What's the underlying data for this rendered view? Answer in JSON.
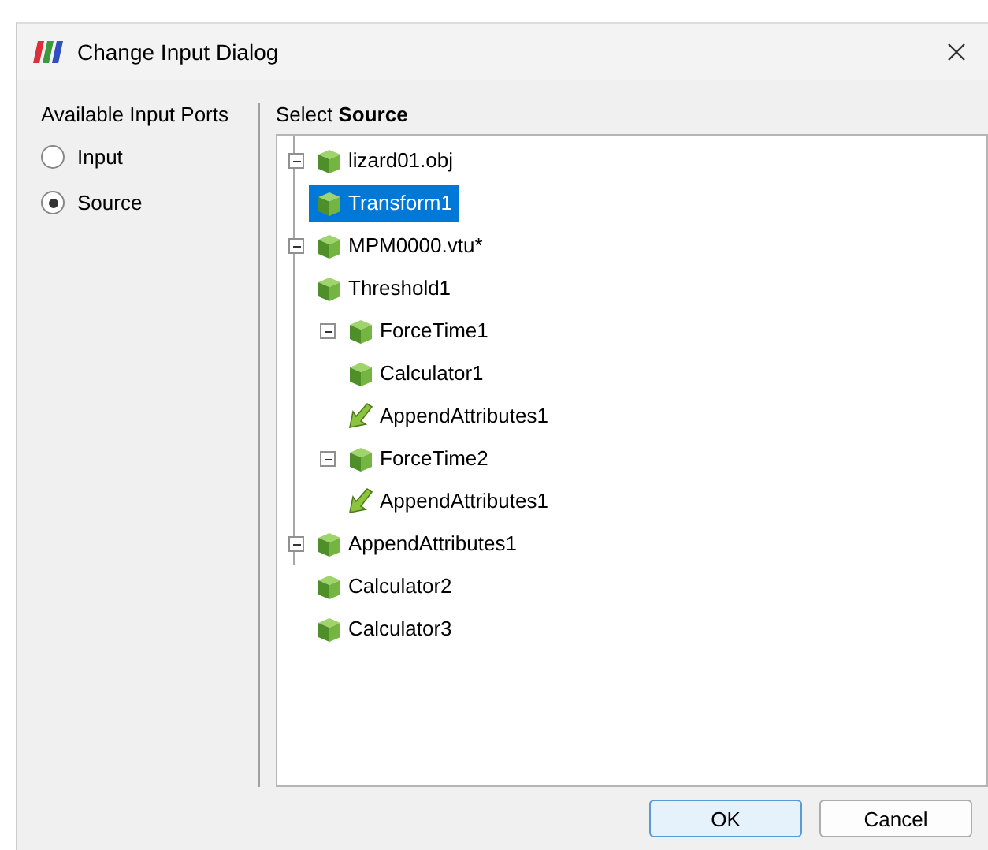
{
  "window": {
    "title": "Change Input Dialog"
  },
  "ports": {
    "label": "Available Input Ports",
    "options": [
      {
        "label": "Input",
        "selected": false
      },
      {
        "label": "Source",
        "selected": true
      }
    ]
  },
  "tree": {
    "heading": "Select **Source**",
    "items": [
      {
        "label": "lizard01.obj",
        "kind": "cube",
        "selected": false,
        "expanded": true,
        "children": [
          {
            "label": "Transform1",
            "kind": "cube",
            "selected": true
          }
        ]
      },
      {
        "label": "MPM0000.vtu*",
        "kind": "cube",
        "selected": false,
        "expanded": true,
        "children": [
          {
            "label": "Threshold1",
            "kind": "cube",
            "selected": false,
            "children": [
              {
                "label": "ForceTime1",
                "kind": "cube",
                "selected": false,
                "expanded": true,
                "children": [
                  {
                    "label": "Calculator1",
                    "kind": "cube",
                    "selected": false,
                    "children": [
                      {
                        "label": "AppendAttributes1",
                        "kind": "arrow",
                        "selected": false
                      }
                    ]
                  }
                ]
              },
              {
                "label": "ForceTime2",
                "kind": "cube",
                "selected": false,
                "expanded": true,
                "children": [
                  {
                    "label": "AppendAttributes1",
                    "kind": "arrow",
                    "selected": false
                  }
                ]
              }
            ]
          }
        ]
      },
      {
        "label": "AppendAttributes1",
        "kind": "cube",
        "selected": false,
        "expanded": true,
        "children": [
          {
            "label": "Calculator2",
            "kind": "cube",
            "selected": false,
            "children": [
              {
                "label": "Calculator3",
                "kind": "cube",
                "selected": false
              }
            ]
          }
        ]
      }
    ]
  },
  "buttons": [
    {
      "label": "OK",
      "kind": "default"
    },
    {
      "label": "Cancel",
      "kind": "normal"
    }
  ]
}
